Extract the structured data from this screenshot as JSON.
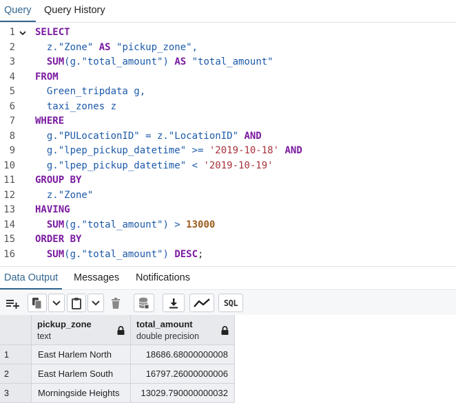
{
  "query_tabs": [
    {
      "label": "Query",
      "active": true
    },
    {
      "label": "Query History",
      "active": false
    }
  ],
  "editor": {
    "lines": [
      {
        "n": "1",
        "fold": true,
        "tokens": [
          {
            "t": "SELECT",
            "c": "kw"
          }
        ]
      },
      {
        "n": "2",
        "tokens": [
          {
            "t": "  ",
            "c": "pl"
          },
          {
            "t": "z.\"Zone\" ",
            "c": "id"
          },
          {
            "t": "AS",
            "c": "kw"
          },
          {
            "t": " ",
            "c": "pl"
          },
          {
            "t": "\"pickup_zone\",",
            "c": "id"
          }
        ]
      },
      {
        "n": "3",
        "tokens": [
          {
            "t": "  ",
            "c": "pl"
          },
          {
            "t": "SUM",
            "c": "kw"
          },
          {
            "t": "(g.\"total_amount\") ",
            "c": "id"
          },
          {
            "t": "AS",
            "c": "kw"
          },
          {
            "t": " ",
            "c": "pl"
          },
          {
            "t": "\"total_amount\"",
            "c": "id"
          }
        ]
      },
      {
        "n": "4",
        "tokens": [
          {
            "t": "FROM",
            "c": "kw"
          }
        ]
      },
      {
        "n": "5",
        "tokens": [
          {
            "t": "  ",
            "c": "pl"
          },
          {
            "t": "Green_tripdata g,",
            "c": "id"
          }
        ]
      },
      {
        "n": "6",
        "tokens": [
          {
            "t": "  ",
            "c": "pl"
          },
          {
            "t": "taxi_zones z",
            "c": "id"
          }
        ]
      },
      {
        "n": "7",
        "tokens": [
          {
            "t": "WHERE",
            "c": "kw"
          }
        ]
      },
      {
        "n": "8",
        "tokens": [
          {
            "t": "  ",
            "c": "pl"
          },
          {
            "t": "g.\"PULocationID\" = z.\"LocationID\" ",
            "c": "id"
          },
          {
            "t": "AND",
            "c": "kw"
          }
        ]
      },
      {
        "n": "9",
        "tokens": [
          {
            "t": "  ",
            "c": "pl"
          },
          {
            "t": "g.\"lpep_pickup_datetime\" >= ",
            "c": "id"
          },
          {
            "t": "'2019-10-18'",
            "c": "str"
          },
          {
            "t": " ",
            "c": "pl"
          },
          {
            "t": "AND",
            "c": "kw"
          }
        ]
      },
      {
        "n": "10",
        "tokens": [
          {
            "t": "  ",
            "c": "pl"
          },
          {
            "t": "g.\"lpep_pickup_datetime\" < ",
            "c": "id"
          },
          {
            "t": "'2019-10-19'",
            "c": "str"
          }
        ]
      },
      {
        "n": "11",
        "tokens": [
          {
            "t": "GROUP BY",
            "c": "kw"
          }
        ]
      },
      {
        "n": "12",
        "tokens": [
          {
            "t": "  ",
            "c": "pl"
          },
          {
            "t": "z.\"Zone\"",
            "c": "id"
          }
        ]
      },
      {
        "n": "13",
        "tokens": [
          {
            "t": "HAVING",
            "c": "kw"
          }
        ]
      },
      {
        "n": "14",
        "tokens": [
          {
            "t": "  ",
            "c": "pl"
          },
          {
            "t": "SUM",
            "c": "kw"
          },
          {
            "t": "(g.\"total_amount\") > ",
            "c": "id"
          },
          {
            "t": "13000",
            "c": "num"
          }
        ]
      },
      {
        "n": "15",
        "tokens": [
          {
            "t": "ORDER BY",
            "c": "kw"
          }
        ]
      },
      {
        "n": "16",
        "tokens": [
          {
            "t": "  ",
            "c": "pl"
          },
          {
            "t": "SUM",
            "c": "kw"
          },
          {
            "t": "(g.\"total_amount\") ",
            "c": "id"
          },
          {
            "t": "DESC",
            "c": "kw"
          },
          {
            "t": ";",
            "c": "pl"
          }
        ]
      }
    ]
  },
  "output_tabs": [
    {
      "label": "Data Output",
      "active": true
    },
    {
      "label": "Messages",
      "active": false
    },
    {
      "label": "Notifications",
      "active": false
    }
  ],
  "toolbar": {
    "icons": [
      "add-row-icon",
      "copy-icon",
      "chevron-down-icon",
      "paste-icon",
      "chevron-down-icon",
      "delete-icon",
      "save-data-icon",
      "download-icon",
      "graph-icon"
    ],
    "sql_label": "SQL"
  },
  "grid": {
    "columns": [
      {
        "name": "pickup_zone",
        "type": "text"
      },
      {
        "name": "total_amount",
        "type": "double precision"
      }
    ],
    "rows": [
      {
        "n": "1",
        "zone": "East Harlem North",
        "amount": "18686.68000000008"
      },
      {
        "n": "2",
        "zone": "East Harlem South",
        "amount": "16797.26000000006"
      },
      {
        "n": "3",
        "zone": "Morningside Heights",
        "amount": "13029.790000000032"
      }
    ]
  },
  "colors": {
    "accent": "#326690",
    "keyword": "#7a1aa0",
    "identifier": "#1c5aa8",
    "string": "#a8303a",
    "number": "#9b5b1a"
  }
}
